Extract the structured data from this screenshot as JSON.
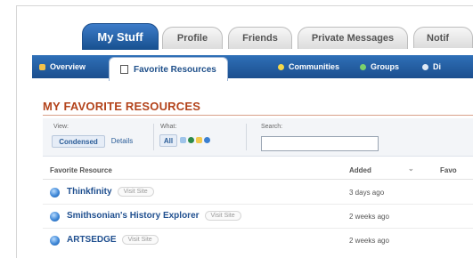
{
  "tabs": [
    {
      "label": "My Stuff",
      "active": true
    },
    {
      "label": "Profile"
    },
    {
      "label": "Friends"
    },
    {
      "label": "Private Messages"
    },
    {
      "label": "Notif"
    }
  ],
  "nav": {
    "items": [
      {
        "label": "Overview"
      },
      {
        "label": "Favorite Resources",
        "active": true
      },
      {
        "label": "Communities"
      },
      {
        "label": "Groups"
      },
      {
        "label": "Di"
      }
    ]
  },
  "page": {
    "heading": "MY FAVORITE RESOURCES"
  },
  "filters": {
    "view_label": "View:",
    "view_options": [
      "Condensed",
      "Details"
    ],
    "what_label": "What:",
    "what_all": "All",
    "search_label": "Search:",
    "search_value": ""
  },
  "table": {
    "columns": [
      "Favorite Resource",
      "Added",
      "Favo"
    ],
    "visit_label": "Visit Site",
    "rows": [
      {
        "name": "Thinkfinity",
        "added": "3 days ago"
      },
      {
        "name": "Smithsonian's History Explorer",
        "added": "2 weeks ago"
      },
      {
        "name": "ARTSEDGE",
        "added": "2 weeks ago"
      }
    ]
  },
  "colors": {
    "tab_active": "#1f5aa3",
    "nav_bar": "#2565ab",
    "heading": "#b3431b",
    "link": "#1f4f8f"
  }
}
